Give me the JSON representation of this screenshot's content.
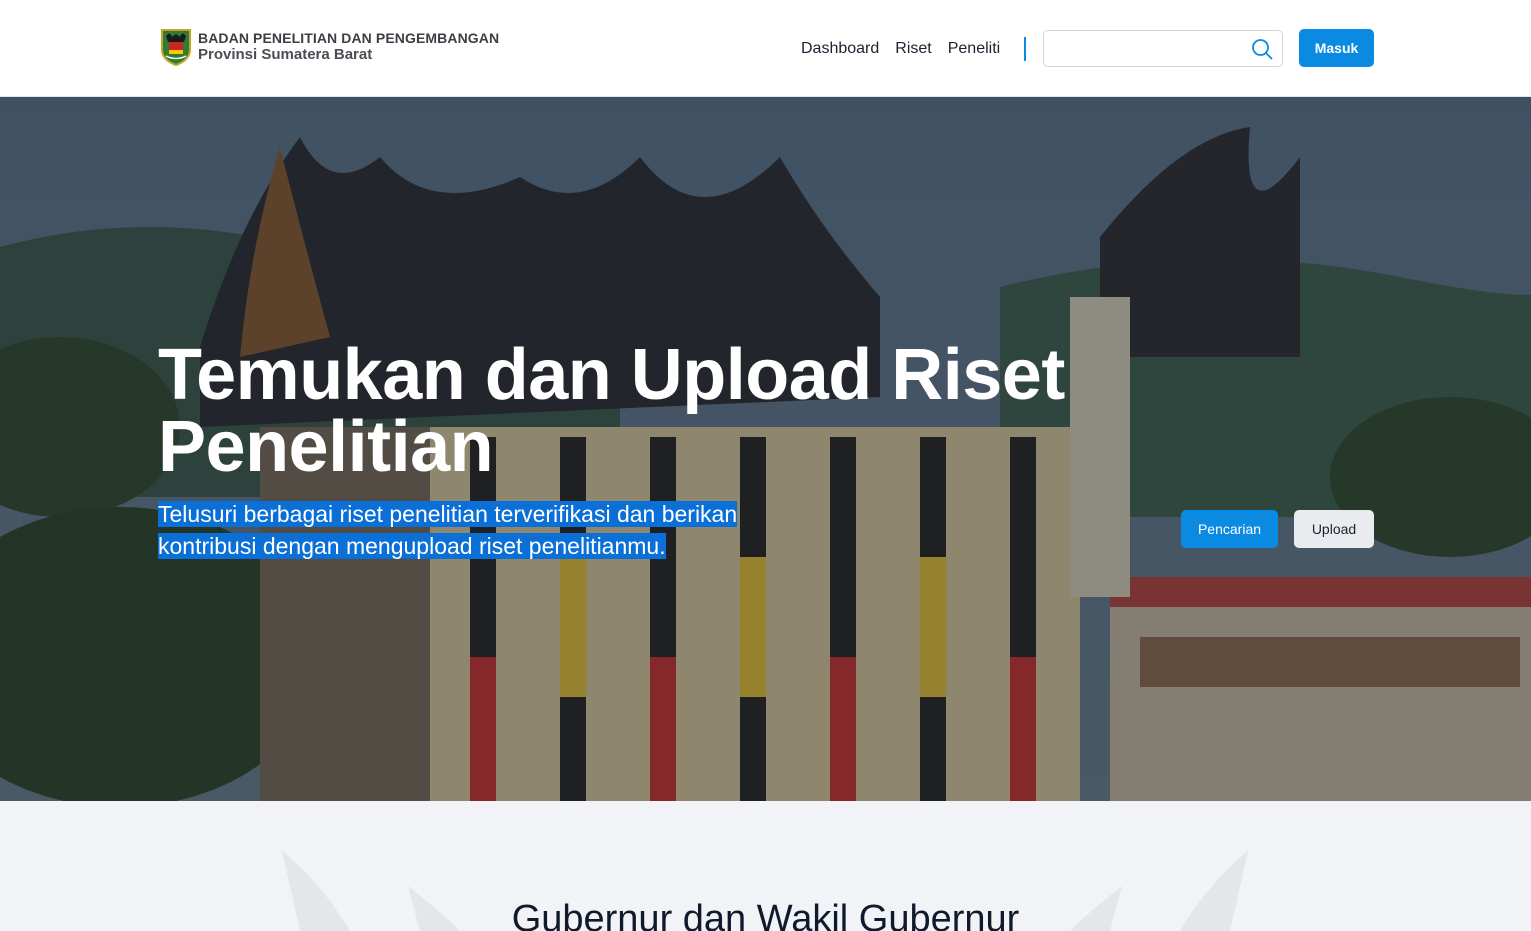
{
  "header": {
    "brand_line1": "BADAN PENELITIAN DAN PENGEMBANGAN",
    "brand_line2": "Provinsi Sumatera Barat",
    "nav": [
      {
        "label": "Dashboard"
      },
      {
        "label": "Riset"
      },
      {
        "label": "Peneliti"
      }
    ],
    "search": {
      "value": "",
      "placeholder": "",
      "icon": "search-icon"
    },
    "login_label": "Masuk"
  },
  "hero": {
    "title_line1": "Temukan dan Upload Riset",
    "title_line2": "Penelitian",
    "subtitle_line1": "Telusuri berbagai riset penelitian terverifikasi dan berikan",
    "subtitle_line2": "kontribusi dengan mengupload riset penelitianmu.",
    "search_button_label": "Pencarian",
    "upload_button_label": "Upload"
  },
  "section": {
    "title": "Gubernur dan Wakil Gubernur"
  },
  "colors": {
    "accent": "#0a8ae0",
    "text_selection": "#0a6fd6",
    "section_bg": "#f1f3f6"
  }
}
